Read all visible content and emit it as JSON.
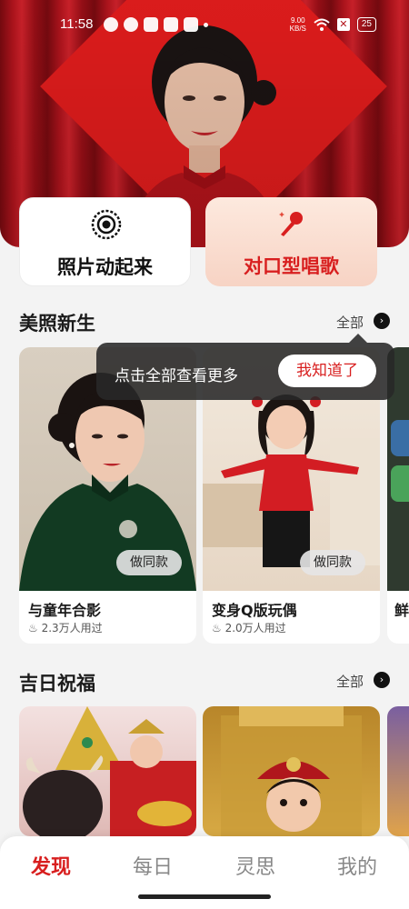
{
  "status": {
    "time": "11:58",
    "net_speed_value": "9.00",
    "net_speed_unit": "KB/S",
    "battery": "25"
  },
  "actions": {
    "photo_animate": "照片动起来",
    "lip_sync_sing": "对口型唱歌"
  },
  "section1": {
    "title": "美照新生",
    "all_label": "全部",
    "cards": [
      {
        "name": "与童年合影",
        "used": "2.3万人用过",
        "same_btn": "做同款"
      },
      {
        "name": "变身Q版玩偶",
        "used": "2.0万人用过",
        "same_btn": "做同款"
      },
      {
        "name": "鲜",
        "used": ""
      }
    ]
  },
  "tooltip": {
    "text": "点击全部查看更多",
    "button": "我知道了"
  },
  "section2": {
    "title": "吉日祝福",
    "all_label": "全部"
  },
  "nav": {
    "items": [
      "发现",
      "每日",
      "灵思",
      "我的"
    ],
    "active": "发现"
  },
  "colors": {
    "accent": "#d81f1f",
    "hero_red": "#e61d1d"
  }
}
